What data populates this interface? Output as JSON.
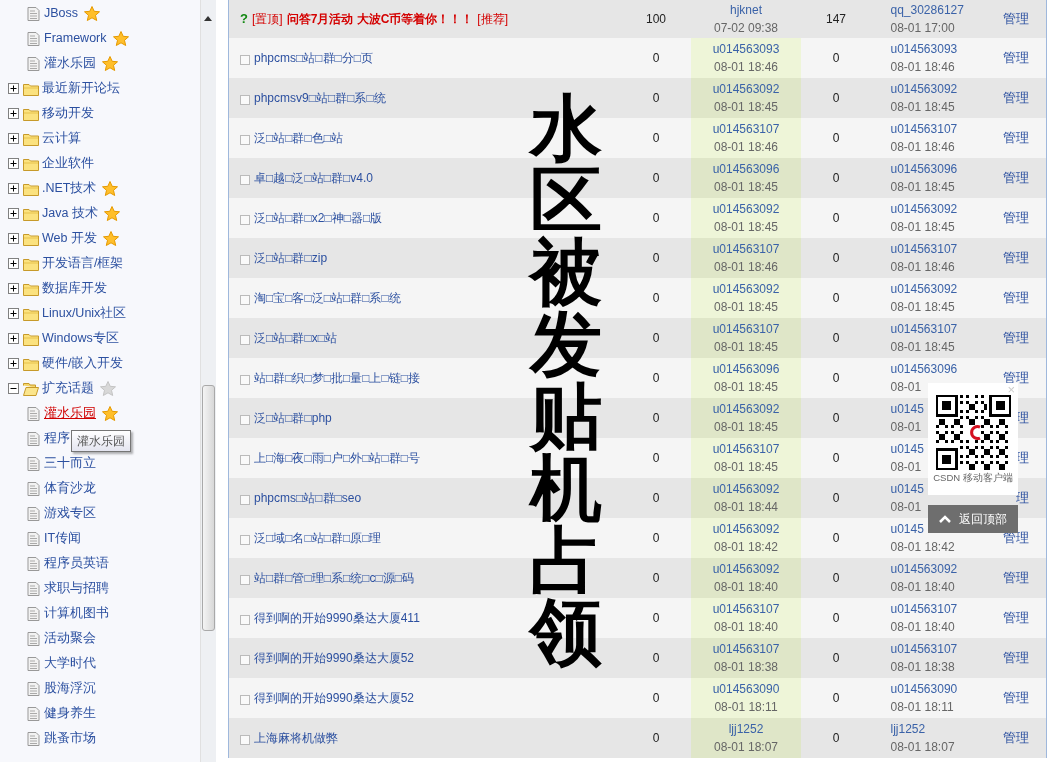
{
  "sidebar": {
    "leading_items": [
      {
        "label": "JBoss",
        "starred": true,
        "selected": false
      },
      {
        "label": "Framework",
        "starred": true,
        "selected": false
      },
      {
        "label": "灌水乐园",
        "starred": true,
        "selected": false
      }
    ],
    "items": [
      {
        "label": "最近新开论坛",
        "expanded": false
      },
      {
        "label": "移动开发",
        "expanded": false
      },
      {
        "label": "云计算",
        "expanded": false
      },
      {
        "label": "企业软件",
        "expanded": false
      },
      {
        "label": ".NET技术",
        "expanded": false,
        "starred": true
      },
      {
        "label": "Java 技术",
        "expanded": false,
        "starred": true
      },
      {
        "label": "Web 开发",
        "expanded": false,
        "starred": true
      },
      {
        "label": "开发语言/框架",
        "expanded": false
      },
      {
        "label": "数据库开发",
        "expanded": false
      },
      {
        "label": "Linux/Unix社区",
        "expanded": false
      },
      {
        "label": "Windows专区",
        "expanded": false
      },
      {
        "label": "硬件/嵌入开发",
        "expanded": false
      },
      {
        "label": "扩充话题",
        "expanded": true,
        "starred": false,
        "children": [
          {
            "label": "灌水乐园",
            "starred": true,
            "selected": true
          },
          {
            "label": "程序",
            "selected": false
          },
          {
            "label": "三十而立",
            "selected": false
          },
          {
            "label": "体育沙龙",
            "selected": false
          },
          {
            "label": "游戏专区",
            "selected": false
          },
          {
            "label": "IT传闻",
            "selected": false
          },
          {
            "label": "程序员英语",
            "selected": false
          },
          {
            "label": "求职与招聘",
            "selected": false
          },
          {
            "label": "计算机图书",
            "selected": false
          },
          {
            "label": "活动聚会",
            "selected": false
          },
          {
            "label": "大学时代",
            "selected": false
          },
          {
            "label": "股海浮沉",
            "selected": false
          },
          {
            "label": "健身养生",
            "selected": false
          },
          {
            "label": "跳蚤市场",
            "selected": false
          }
        ]
      }
    ],
    "tooltip": "灌水乐园"
  },
  "table": {
    "rows": [
      {
        "kind": "pinned",
        "marker": "?",
        "prefix": "[置顶]",
        "title": "问答7月活动 大波C币等着你！！！",
        "suffix": "[推荐]",
        "count_1": "100",
        "author": {
          "user": "hjknet",
          "time": "07-02 09:38"
        },
        "count_2": "147",
        "last_reply": {
          "user": "qq_30286127",
          "time": "08-01 17:00"
        },
        "action": "管理"
      },
      {
        "kind": "normal",
        "title": "phpcms□站□群□分□页",
        "count_1": "0",
        "author": {
          "user": "u014563093",
          "time": "08-01 18:46"
        },
        "count_2": "0",
        "last_reply": {
          "user": "u014563093",
          "time": "08-01 18:46"
        },
        "action": "管理"
      },
      {
        "kind": "normal",
        "title": "phpcmsv9□站□群□系□统",
        "count_1": "0",
        "author": {
          "user": "u014563092",
          "time": "08-01 18:45"
        },
        "count_2": "0",
        "last_reply": {
          "user": "u014563092",
          "time": "08-01 18:45"
        },
        "action": "管理"
      },
      {
        "kind": "normal",
        "title": "泛□站□群□色□站",
        "count_1": "0",
        "author": {
          "user": "u014563107",
          "time": "08-01 18:46"
        },
        "count_2": "0",
        "last_reply": {
          "user": "u014563107",
          "time": "08-01 18:46"
        },
        "action": "管理"
      },
      {
        "kind": "normal",
        "title": "卓□越□泛□站□群□v4.0",
        "count_1": "0",
        "author": {
          "user": "u014563096",
          "time": "08-01 18:45"
        },
        "count_2": "0",
        "last_reply": {
          "user": "u014563096",
          "time": "08-01 18:45"
        },
        "action": "管理"
      },
      {
        "kind": "normal",
        "title": "泛□站□群□x2□神□器□版",
        "count_1": "0",
        "author": {
          "user": "u014563092",
          "time": "08-01 18:45"
        },
        "count_2": "0",
        "last_reply": {
          "user": "u014563092",
          "time": "08-01 18:45"
        },
        "action": "管理"
      },
      {
        "kind": "normal",
        "title": "泛□站□群□zip",
        "count_1": "0",
        "author": {
          "user": "u014563107",
          "time": "08-01 18:46"
        },
        "count_2": "0",
        "last_reply": {
          "user": "u014563107",
          "time": "08-01 18:46"
        },
        "action": "管理"
      },
      {
        "kind": "normal",
        "title": "淘□宝□客□泛□站□群□系□统",
        "count_1": "0",
        "author": {
          "user": "u014563092",
          "time": "08-01 18:45"
        },
        "count_2": "0",
        "last_reply": {
          "user": "u014563092",
          "time": "08-01 18:45"
        },
        "action": "管理"
      },
      {
        "kind": "normal",
        "title": "泛□站□群□x□站",
        "count_1": "0",
        "author": {
          "user": "u014563107",
          "time": "08-01 18:45"
        },
        "count_2": "0",
        "last_reply": {
          "user": "u014563107",
          "time": "08-01 18:45"
        },
        "action": "管理"
      },
      {
        "kind": "normal",
        "title": "站□群□织□梦□批□量□上□链□接",
        "count_1": "0",
        "author": {
          "user": "u014563096",
          "time": "08-01 18:45"
        },
        "count_2": "0",
        "last_reply": {
          "user": "u014563096",
          "time": "08-01"
        },
        "action": "管理"
      },
      {
        "kind": "normal",
        "title": "泛□站□群□php",
        "count_1": "0",
        "author": {
          "user": "u014563092",
          "time": "08-01 18:45"
        },
        "count_2": "0",
        "last_reply": {
          "user": "u0145",
          "time": "08-01"
        },
        "action": "理"
      },
      {
        "kind": "normal",
        "title": "上□海□夜□雨□户□外□站□群□号",
        "count_1": "0",
        "author": {
          "user": "u014563107",
          "time": "08-01 18:45"
        },
        "count_2": "0",
        "last_reply": {
          "user": "u0145",
          "time": "08-01"
        },
        "action": "理"
      },
      {
        "kind": "normal",
        "title": "phpcms□站□群□seo",
        "count_1": "0",
        "author": {
          "user": "u014563092",
          "time": "08-01 18:44"
        },
        "count_2": "0",
        "last_reply": {
          "user": "u0145",
          "time": "08-01"
        },
        "action": "理"
      },
      {
        "kind": "normal",
        "title": "泛□域□名□站□群□原□理",
        "count_1": "0",
        "author": {
          "user": "u014563092",
          "time": "08-01 18:42"
        },
        "count_2": "0",
        "last_reply": {
          "user": "u0145",
          "time": "08-01 18:42"
        },
        "action": "管理"
      },
      {
        "kind": "normal",
        "title": "站□群□管□理□系□统□c□源□码",
        "count_1": "0",
        "author": {
          "user": "u014563092",
          "time": "08-01 18:40"
        },
        "count_2": "0",
        "last_reply": {
          "user": "u014563092",
          "time": "08-01 18:40"
        },
        "action": "管理"
      },
      {
        "kind": "normal",
        "title": "得到啊的开始9990桑达大厦411",
        "count_1": "0",
        "author": {
          "user": "u014563107",
          "time": "08-01 18:40"
        },
        "count_2": "0",
        "last_reply": {
          "user": "u014563107",
          "time": "08-01 18:40"
        },
        "action": "管理"
      },
      {
        "kind": "normal",
        "title": "得到啊的开始9990桑达大厦52",
        "count_1": "0",
        "author": {
          "user": "u014563107",
          "time": "08-01 18:38"
        },
        "count_2": "0",
        "last_reply": {
          "user": "u014563107",
          "time": "08-01 18:38"
        },
        "action": "管理"
      },
      {
        "kind": "normal",
        "title": "得到啊的开始9990桑达大厦52",
        "count_1": "0",
        "author": {
          "user": "u014563090",
          "time": "08-01 18:11"
        },
        "count_2": "0",
        "last_reply": {
          "user": "u014563090",
          "time": "08-01 18:11"
        },
        "action": "管理"
      },
      {
        "kind": "normal",
        "title": "上海麻将机做弊",
        "count_1": "0",
        "author": {
          "user": "ljj1252",
          "time": "08-01 18:07"
        },
        "count_2": "0",
        "last_reply": {
          "user": "ljj1252",
          "time": "08-01 18:07"
        },
        "action": "管理"
      }
    ]
  },
  "overlay_caption": "水区被发贴机占领",
  "app_popup": {
    "close": "×",
    "caption": "CSDN 移动客户端",
    "back_to_top": "返回顶部"
  }
}
